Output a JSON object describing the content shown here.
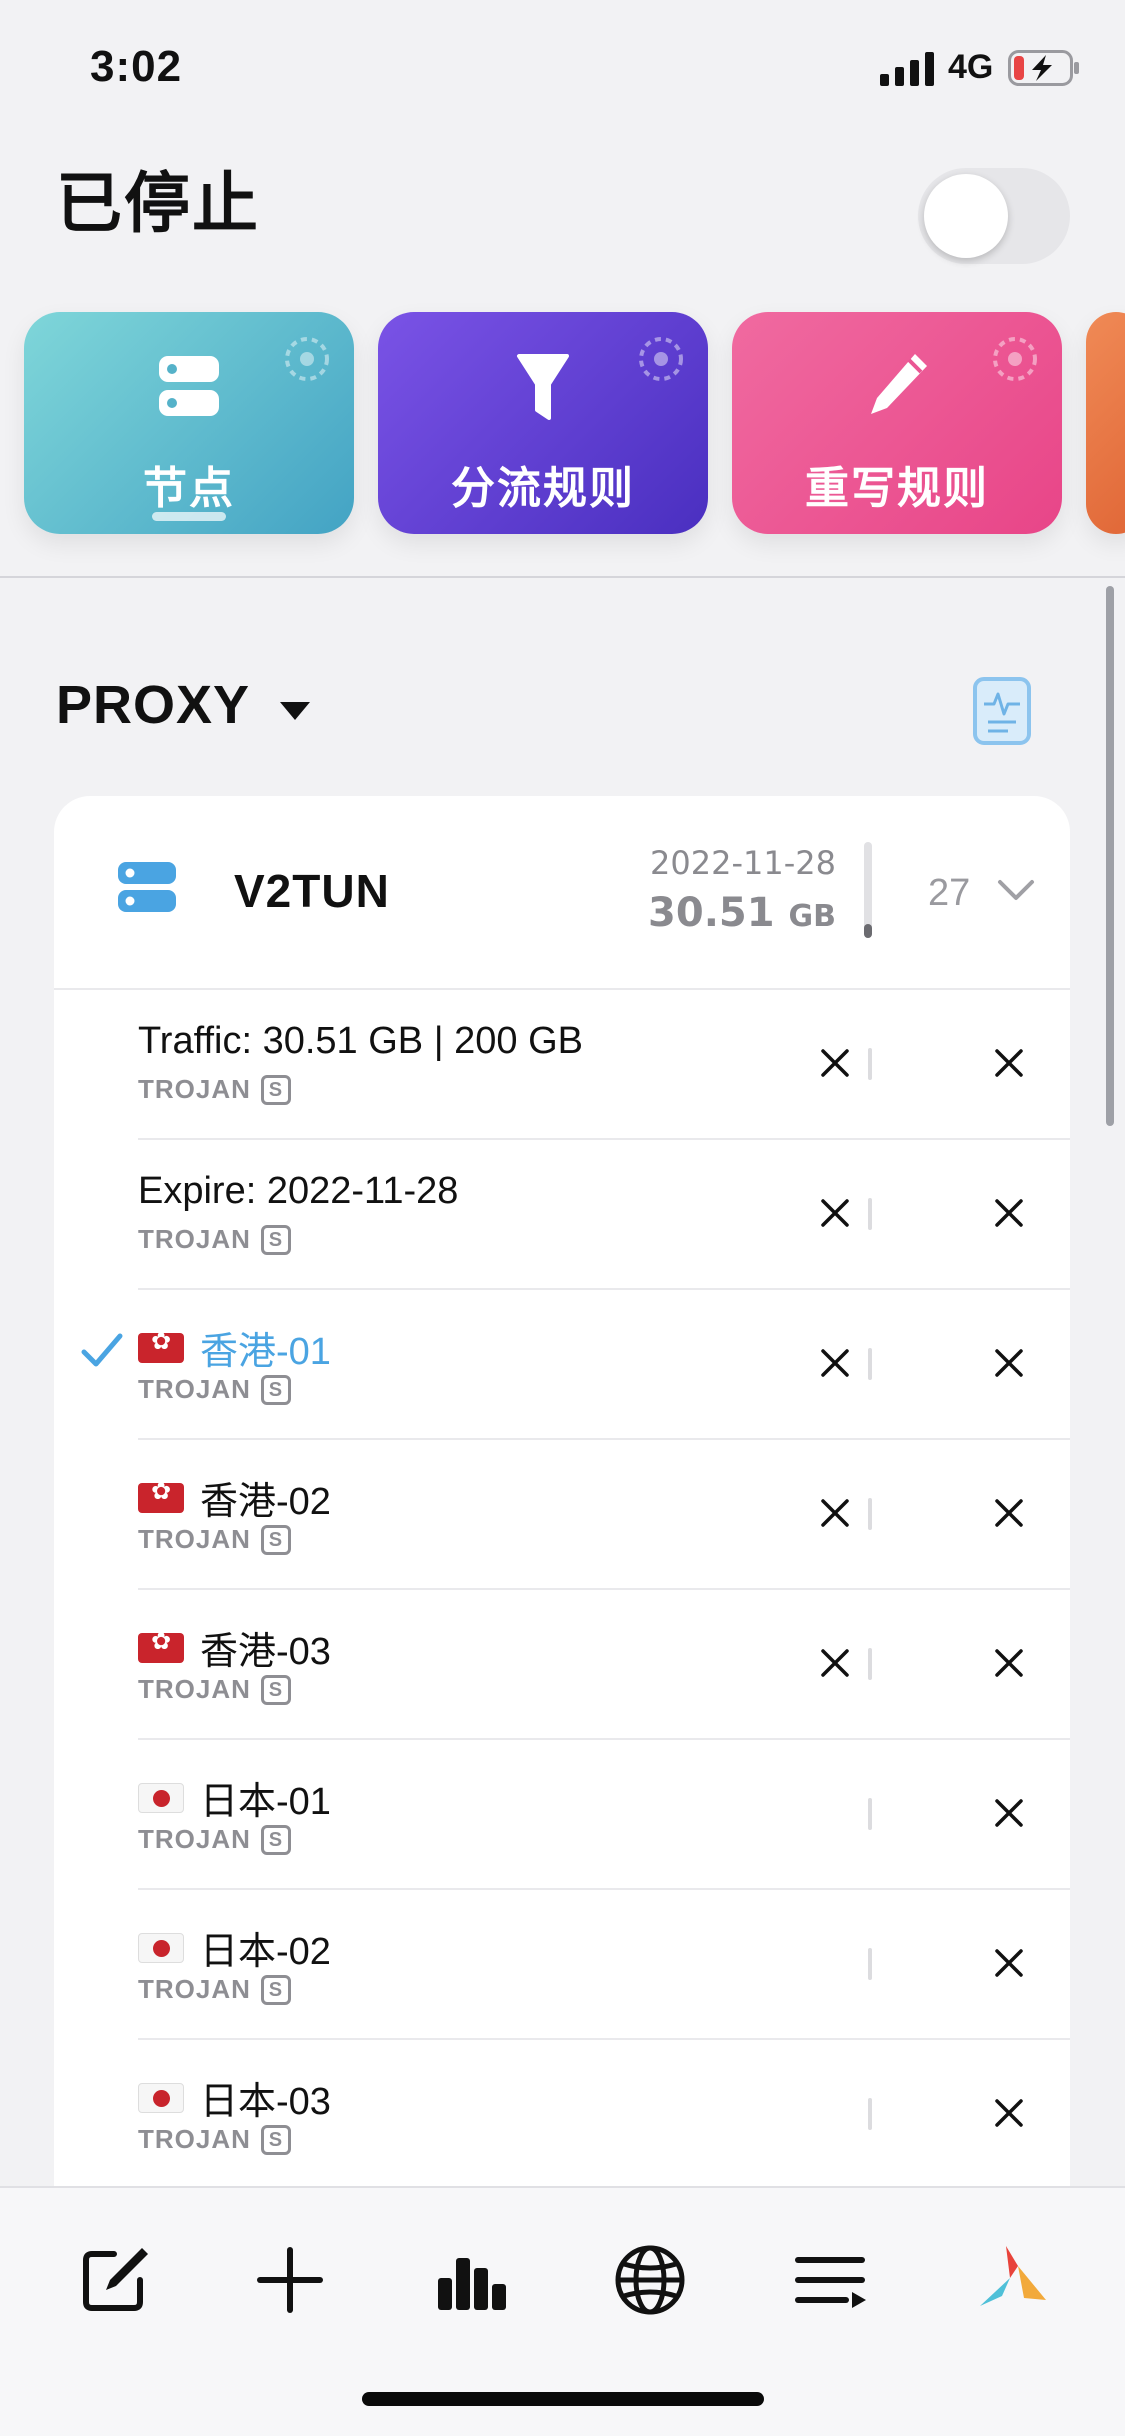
{
  "status_bar": {
    "time": "3:02",
    "network": "4G"
  },
  "header": {
    "title": "已停止",
    "vpn_enabled": false
  },
  "tiles": [
    {
      "label": "节点",
      "icon": "server-icon",
      "active": true
    },
    {
      "label": "分流规则",
      "icon": "filter-icon",
      "active": false
    },
    {
      "label": "重写规则",
      "icon": "pencil-icon",
      "active": false
    }
  ],
  "group": {
    "name": "PROXY"
  },
  "provider": {
    "name": "V2TUN",
    "expire_date": "2022-11-28",
    "traffic_value": "30.51",
    "traffic_unit": "GB",
    "node_count": "27"
  },
  "nodes": [
    {
      "name": "Traffic: 30.51 GB | 200 GB",
      "protocol": "TROJAN",
      "badge": "S",
      "flag": "",
      "selected": false,
      "x1": true
    },
    {
      "name": "Expire: 2022-11-28",
      "protocol": "TROJAN",
      "badge": "S",
      "flag": "",
      "selected": false,
      "x1": true
    },
    {
      "name": "香港-01",
      "protocol": "TROJAN",
      "badge": "S",
      "flag": "hk",
      "selected": true,
      "x1": true
    },
    {
      "name": "香港-02",
      "protocol": "TROJAN",
      "badge": "S",
      "flag": "hk",
      "selected": false,
      "x1": true
    },
    {
      "name": "香港-03",
      "protocol": "TROJAN",
      "badge": "S",
      "flag": "hk",
      "selected": false,
      "x1": true
    },
    {
      "name": "日本-01",
      "protocol": "TROJAN",
      "badge": "S",
      "flag": "jp",
      "selected": false,
      "x1": false
    },
    {
      "name": "日本-02",
      "protocol": "TROJAN",
      "badge": "S",
      "flag": "jp",
      "selected": false,
      "x1": false
    },
    {
      "name": "日本-03",
      "protocol": "TROJAN",
      "badge": "S",
      "flag": "jp",
      "selected": false,
      "x1": false
    }
  ],
  "tabbar": [
    "edit-icon",
    "plus-icon",
    "stats-icon",
    "globe-icon",
    "list-icon",
    "app-logo-icon"
  ],
  "colors": {
    "accent": "#4aa4e2",
    "tile1": "#43a3c4",
    "tile2": "#5a3cd0",
    "tile3": "#e84588"
  }
}
